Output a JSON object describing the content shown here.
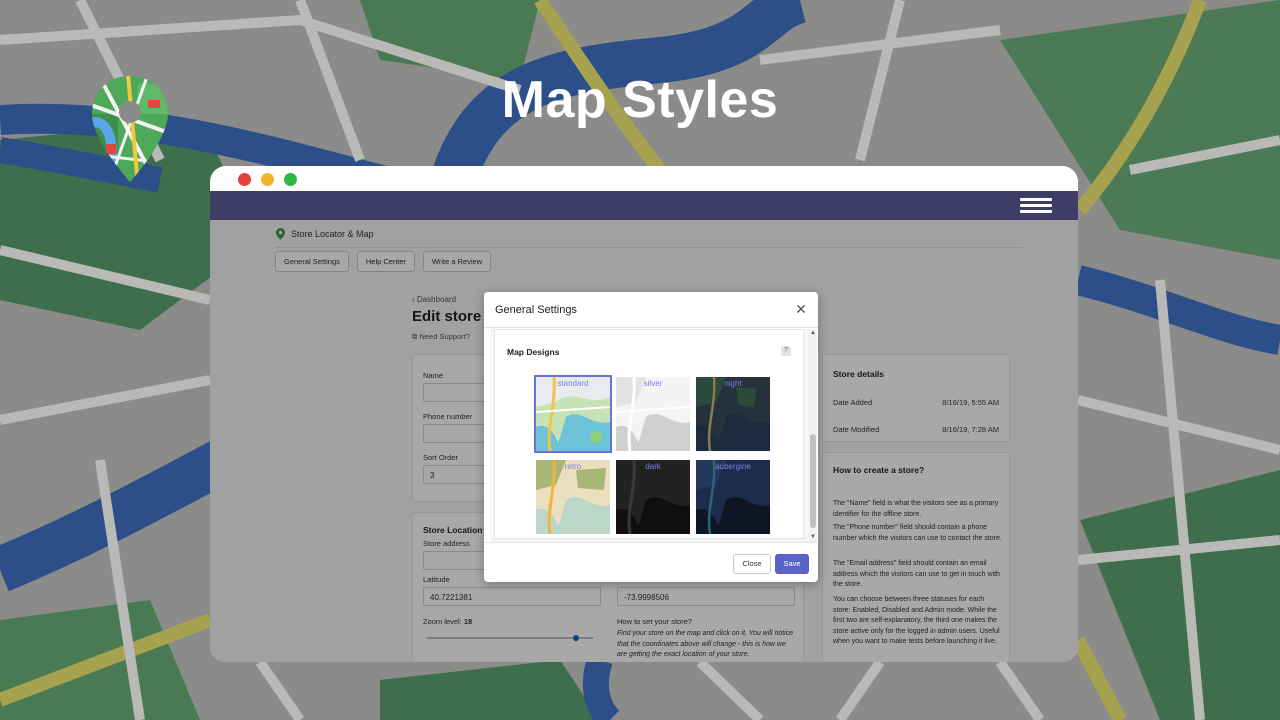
{
  "hero": {
    "title": "Map Styles"
  },
  "colors": {
    "appbar": "#3f3d66",
    "accent": "#5c63c6",
    "tile_label": "#7b7fe0"
  },
  "icons": {
    "logo": "map-pin-icon",
    "menu": "hamburger-menu-icon",
    "close": "close-icon"
  },
  "app": {
    "breadcrumb": "Store Locator & Map",
    "top_buttons": [
      "General Settings",
      "Help Center",
      "Write a Review"
    ],
    "back_link": "Dashboard",
    "page_title": "Edit store",
    "need_support": "Need Support?"
  },
  "form": {
    "name_label": "Name",
    "phone_label": "Phone number",
    "sort_label": "Sort Order",
    "sort_value": "3",
    "location_title": "Store Location",
    "address_label": "Store address",
    "latitude_label": "Latitude",
    "latitude_value": "40.7221381",
    "longitude_value": "-73.9998506",
    "zoom_label": "Zoom level: ",
    "zoom_value": "18",
    "how_title": "How to set your store?",
    "how_text": "Find your store on the map and click on it. You will notice that the coordinates above will change - this is how we are getting the exact location of your store."
  },
  "sidebar": {
    "details_title": "Store details",
    "date_added_label": "Date Added",
    "date_added_value": "8/16/19, 5:55 AM",
    "date_modified_label": "Date Modified",
    "date_modified_value": "8/16/19, 7:28 AM",
    "howto_title": "How to create a store?",
    "p1": "The \"Name\" field is what the visitors see as a primary identifier for the offline store.",
    "p2": "The \"Phone number\" field should contain a phone number which the visitors can use to contact the store.",
    "p3": "The \"Email address\" field should contain an email address which the visitors can use to get in touch with the store.",
    "p4": "You can choose between three statuses for each store: Enabled, Disabled and Admin mode. While the first two are self-explanatory, the third one makes the store active only for the logged in admin users. Useful when you want to make tests before launching it live."
  },
  "modal": {
    "title": "General Settings",
    "section_title": "Map Designs",
    "help": "?",
    "designs": [
      {
        "label": "standard",
        "selected": true
      },
      {
        "label": "silver",
        "selected": false
      },
      {
        "label": "night",
        "selected": false
      },
      {
        "label": "retro",
        "selected": false
      },
      {
        "label": "dark",
        "selected": false
      },
      {
        "label": "aubergine",
        "selected": false
      }
    ],
    "close_label": "Close",
    "save_label": "Save"
  }
}
